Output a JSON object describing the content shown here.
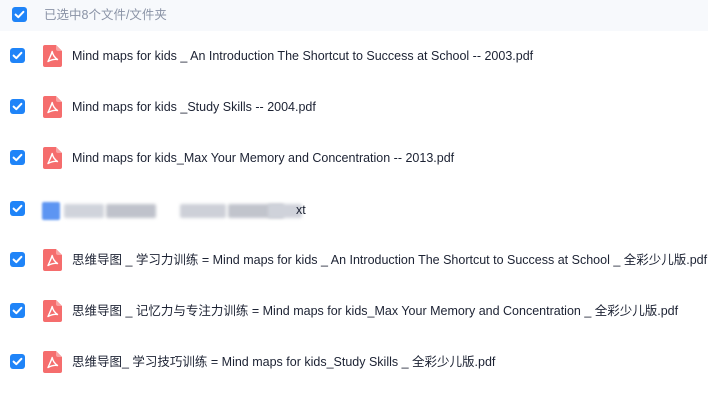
{
  "header": {
    "selection_label": "已选中8个文件/文件夹",
    "checked": true
  },
  "files": [
    {
      "name": "Mind maps for kids _ An Introduction The Shortcut to Success at School -- 2003.pdf",
      "icon": "pdf-icon",
      "checked": true
    },
    {
      "name": "Mind maps for kids _Study Skills -- 2004.pdf",
      "icon": "pdf-icon",
      "checked": true
    },
    {
      "name": "Mind maps for kids_Max Your Memory and Concentration -- 2013.pdf",
      "icon": "pdf-icon",
      "checked": true
    },
    {
      "name_visible_suffix": "xt",
      "icon": "txt-icon",
      "blurred": true,
      "checked": true
    },
    {
      "name": "思维导图 _ 学习力训练 = Mind maps for kids _ An Introduction The Shortcut to Success at School _ 全彩少儿版.pdf",
      "icon": "pdf-icon",
      "checked": true
    },
    {
      "name": "思维导图 _ 记忆力与专注力训练 = Mind maps for kids_Max Your Memory and Concentration _ 全彩少儿版.pdf",
      "icon": "pdf-icon",
      "checked": true
    },
    {
      "name": "思维导图_ 学习技巧训练 = Mind maps for kids_Study Skills _ 全彩少儿版.pdf",
      "icon": "pdf-icon",
      "checked": true
    }
  ],
  "colors": {
    "checkbox": "#1f84f8",
    "pdf_icon": "#f56d6d",
    "header_text": "#8a93a6",
    "background": "#f7f9fc"
  }
}
